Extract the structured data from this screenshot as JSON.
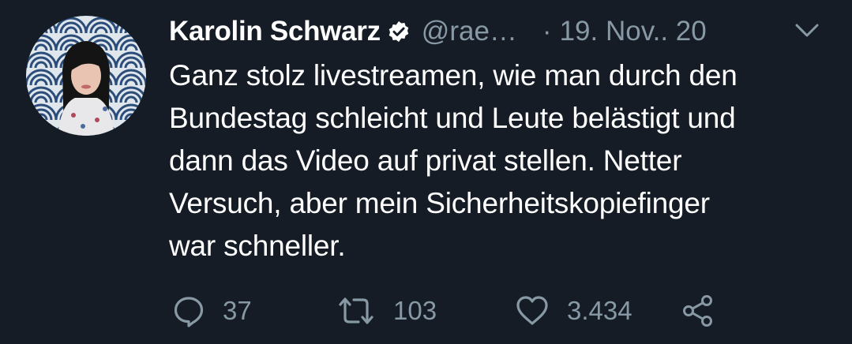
{
  "tweet": {
    "author_name": "Karolin Schwarz",
    "handle": "@rae…",
    "separator": "·",
    "date": "19. Nov.. 20",
    "text": "Ganz stolz livestreamen, wie man durch den\nBundestag schleicht und Leute belästigt und\ndann das Video auf privat stellen. Netter\nVersuch, aber mein Sicherheitskopiefinger\nwar schneller.",
    "verified": true
  },
  "actions": {
    "reply_count": "37",
    "retweet_count": "103",
    "like_count": "3.434"
  },
  "icons": {
    "verified": "verified-badge-icon",
    "menu": "chevron-down-icon",
    "reply": "reply-icon",
    "retweet": "retweet-icon",
    "like": "heart-icon",
    "share": "share-icon"
  },
  "colors": {
    "background": "#151c26",
    "text": "#ffffff",
    "secondary": "#8899a6"
  }
}
